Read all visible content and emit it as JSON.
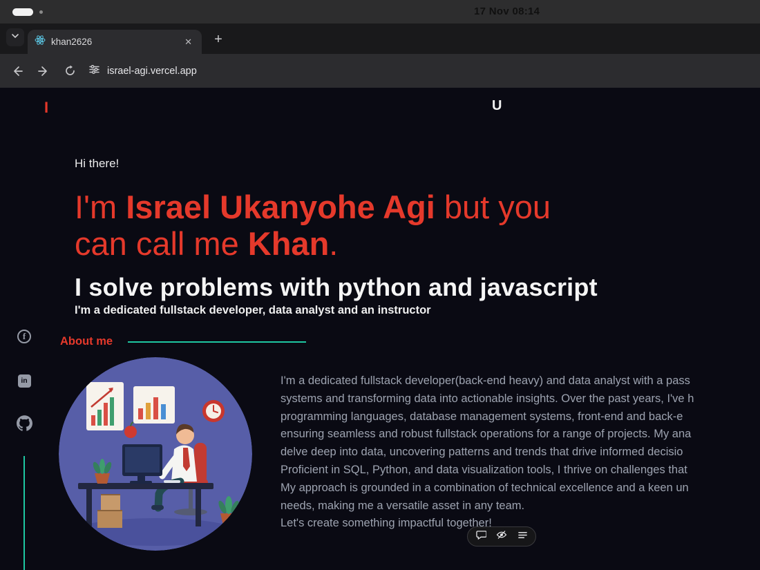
{
  "system_bar": {
    "time": "17 Nov  08:14"
  },
  "browser": {
    "tab_title": "khan2626",
    "close_glyph": "✕",
    "newtab_glyph": "+",
    "url": "israel-agi.vercel.app"
  },
  "page": {
    "logo": "I",
    "nav_letter": "U",
    "greeting": "Hi there!",
    "hero": {
      "line1_pre": "I'm ",
      "line1_name": "Israel Ukanyohe Agi",
      "line1_post": " but you",
      "line2_pre": "can call me ",
      "line2_name": "Khan",
      "line2_post": ".",
      "tagline": "I solve problems with python and javascript",
      "subtitle": "I'm a dedicated fullstack developer, data analyst and an instructor"
    },
    "about": {
      "heading": "About me",
      "lines": [
        "I'm a dedicated fullstack developer(back-end heavy) and data analyst with a pass",
        "systems and transforming data into actionable insights. Over the past years, I've h",
        "programming languages, database management systems, front-end and back-e",
        "ensuring seamless and robust fullstack operations for a range of projects. My ana",
        "delve deep into data, uncovering patterns and trends that drive informed decisio",
        "Proficient in SQL, Python, and data visualization tools, I thrive on challenges that",
        "My approach is grounded in a combination of technical excellence and a keen un",
        "needs, making me a versatile asset in any team.",
        "Let's create something impactful together!"
      ]
    },
    "social": {
      "facebook_glyph": "f",
      "linkedin_glyph": "in"
    }
  },
  "colors": {
    "accent_red": "#e5392b",
    "accent_teal": "#1ec9a2",
    "page_bg": "#0a0a13"
  }
}
